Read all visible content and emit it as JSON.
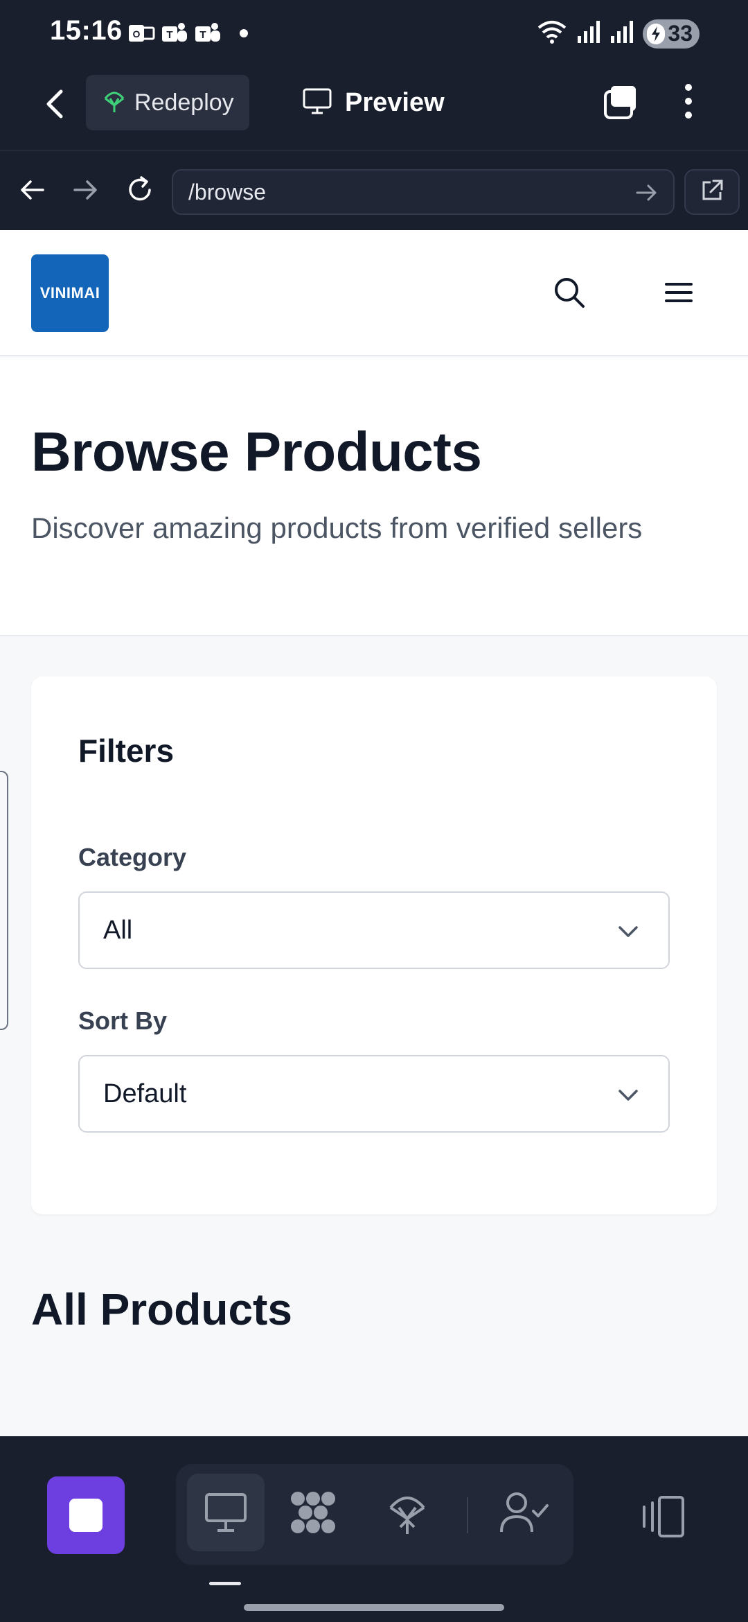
{
  "status_bar": {
    "time": "15:16",
    "battery": "33",
    "icons": [
      "outlook-icon",
      "teams-icon",
      "teams-icon",
      "notification-dot",
      "wifi-icon",
      "signal-icon",
      "signal-icon",
      "battery-icon"
    ]
  },
  "toolbar": {
    "redeploy_label": "Redeploy",
    "preview_label": "Preview"
  },
  "browser": {
    "url": "/browse"
  },
  "site": {
    "logo_text": "VINIMAI",
    "brand_color": "#1265b8"
  },
  "hero": {
    "title": "Browse Products",
    "subtitle": "Discover amazing products from verified sellers"
  },
  "filters": {
    "title": "Filters",
    "category_label": "Category",
    "category_value": "All",
    "sort_label": "Sort By",
    "sort_value": "Default"
  },
  "products": {
    "heading": "All Products"
  },
  "dock": {
    "accent_color": "#6d3fe0",
    "items": [
      "desktop-icon",
      "apps-icon",
      "deploy-icon",
      "user-check-icon"
    ]
  }
}
